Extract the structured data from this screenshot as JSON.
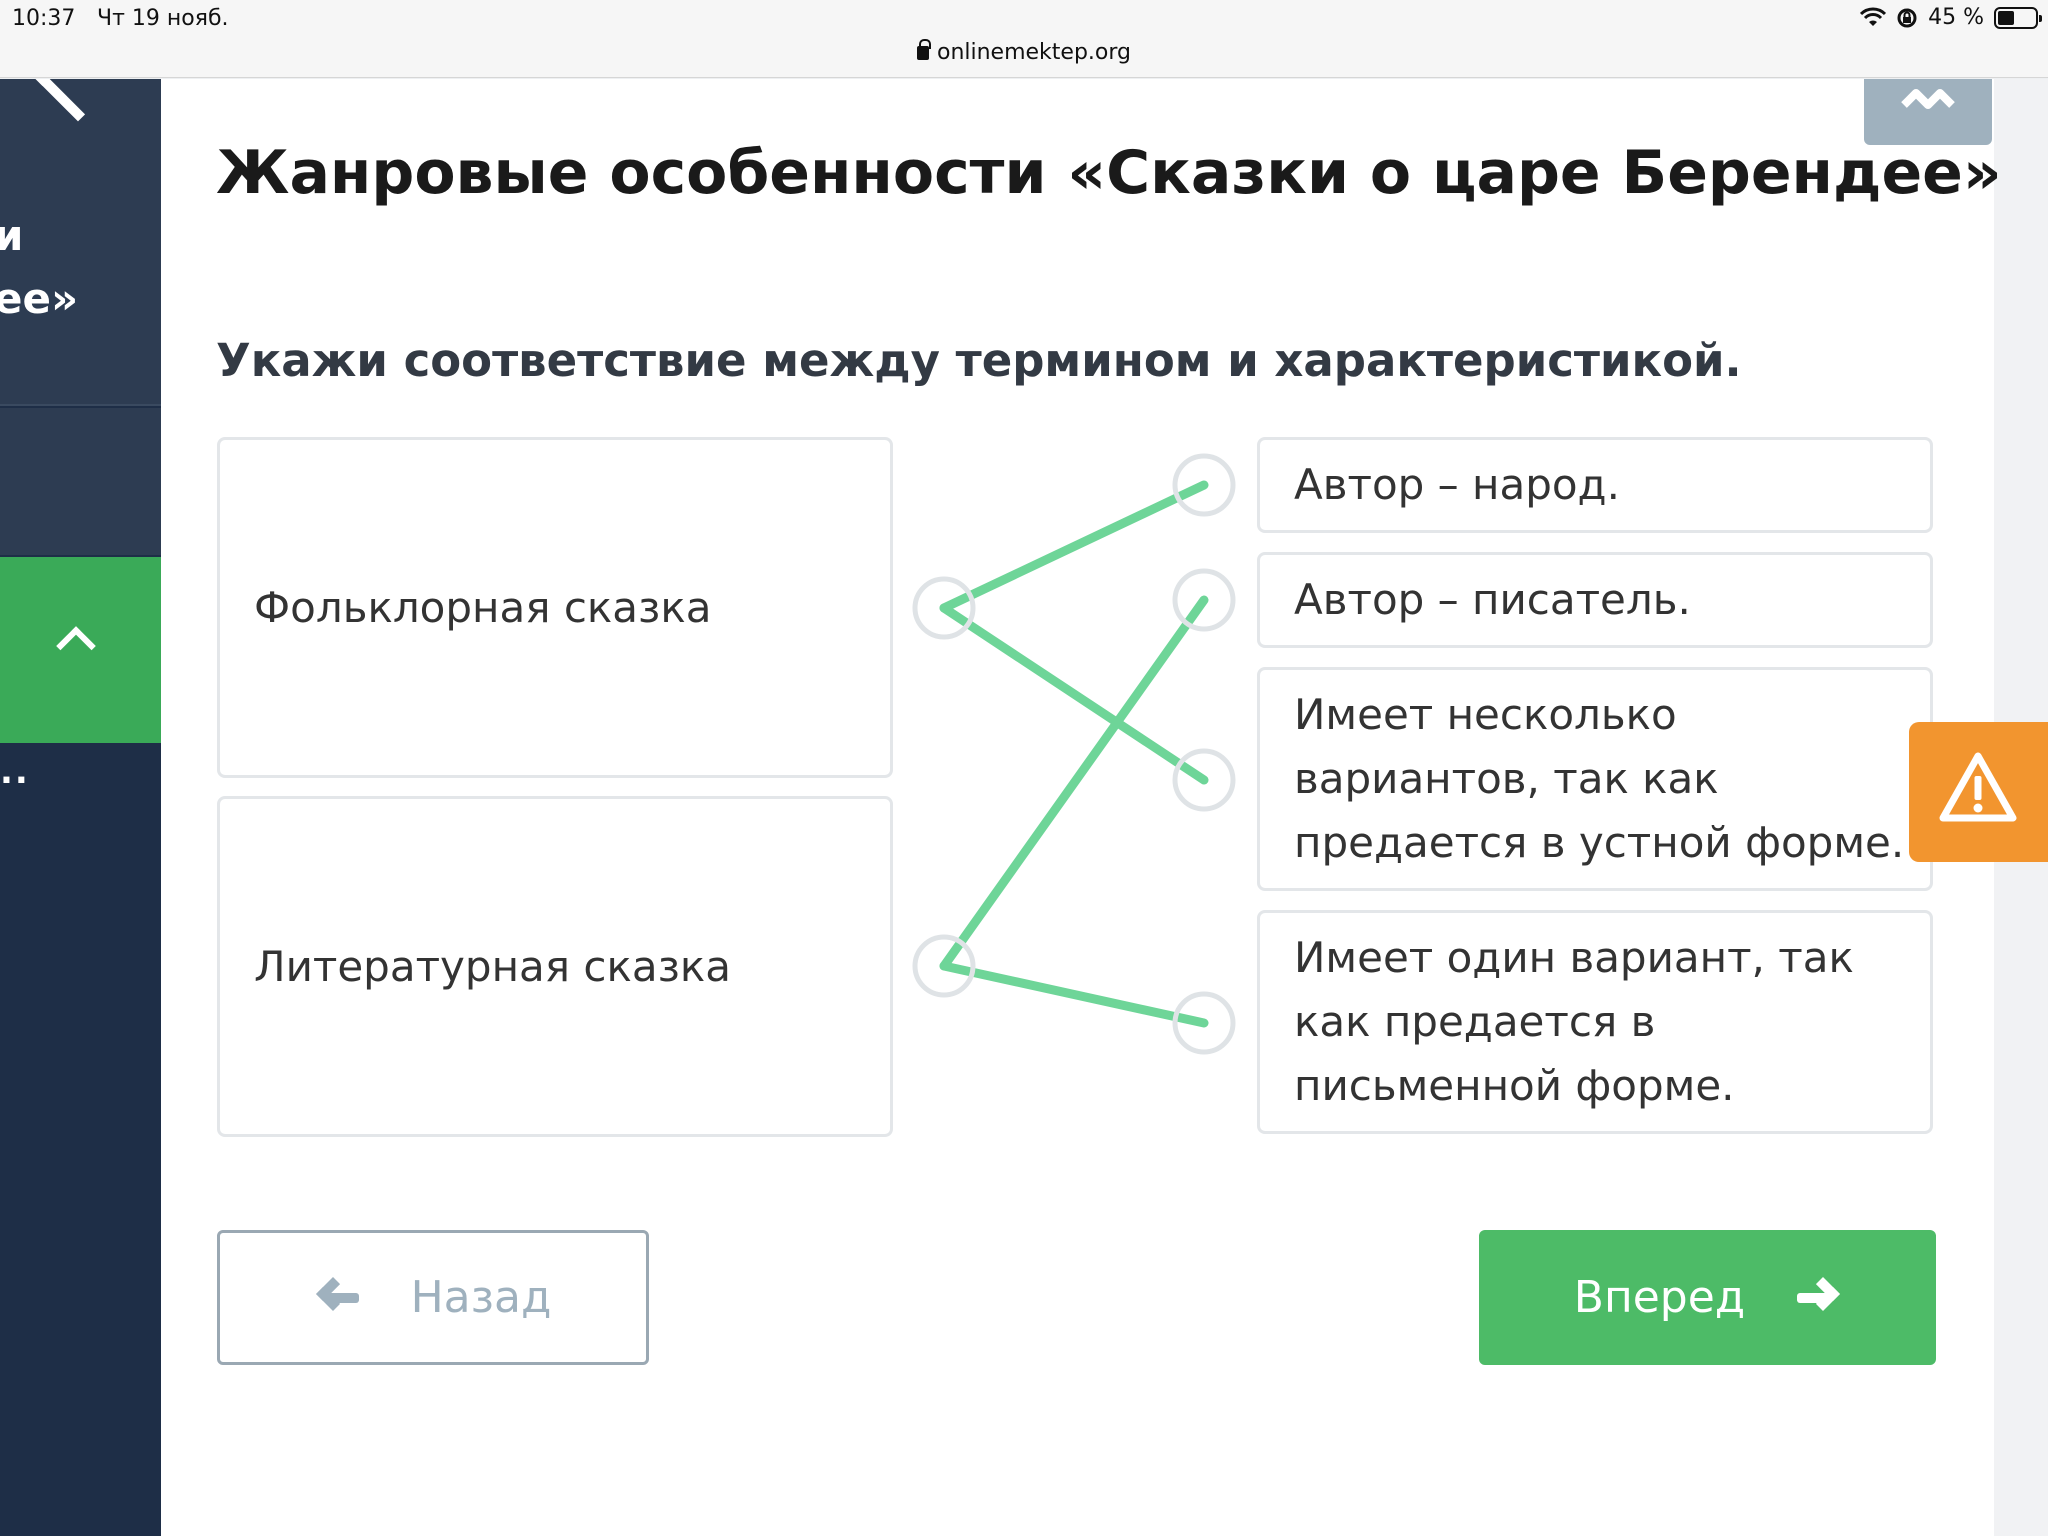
{
  "status_bar": {
    "time": "10:37",
    "date": "Чт 19 нояб.",
    "url": "onlinemektep.org",
    "battery": "45 %",
    "battery_level": 0.45
  },
  "sidebar": {
    "text_line1": "и",
    "text_line2": "ее»",
    "dots": ".."
  },
  "lesson": {
    "title": "Жанровые особенности «Сказки о царе Берендее»",
    "question": "Укажи соответствие между термином и характеристикой."
  },
  "terms": [
    "Фольклорная сказка",
    "Литературная сказка"
  ],
  "descriptions": [
    "Автор – народ.",
    "Автор – писатель.",
    "Имеет несколько вариантов, так как предается в устной форме.",
    "Имеет один вариант, так как предается в письменной форме."
  ],
  "matches": [
    {
      "term": 0,
      "description": 0
    },
    {
      "term": 0,
      "description": 2
    },
    {
      "term": 1,
      "description": 1
    },
    {
      "term": 1,
      "description": 3
    }
  ],
  "buttons": {
    "back": "Назад",
    "next": "Вперед"
  },
  "colors": {
    "accent_green": "#4dbb67",
    "line_green": "#6ed598",
    "sidebar_dark": "#1e2e47",
    "warning_orange": "#f2952f"
  }
}
